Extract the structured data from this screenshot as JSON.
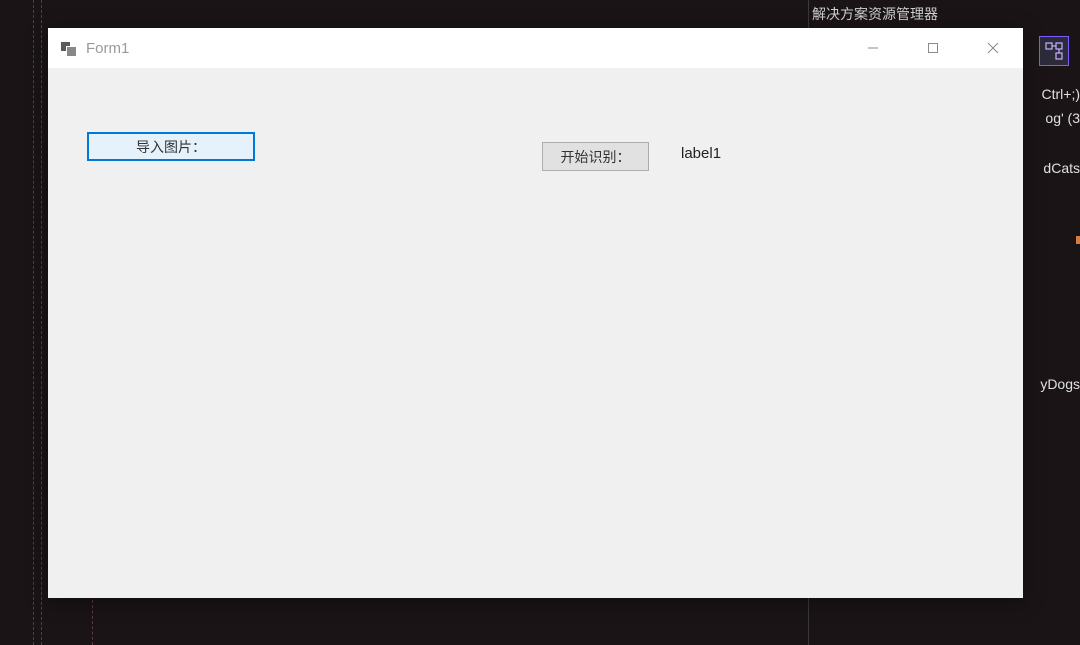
{
  "solution_explorer": {
    "title": "解决方案资源管理器"
  },
  "side_texts": {
    "line1": "Ctrl+;)",
    "line2": "og' (3",
    "line3": "dCats",
    "line4": "yDogs"
  },
  "form": {
    "title": "Form1",
    "buttons": {
      "import_label": "导入图片：",
      "recognize_label": "开始识别："
    },
    "label1": "label1"
  }
}
